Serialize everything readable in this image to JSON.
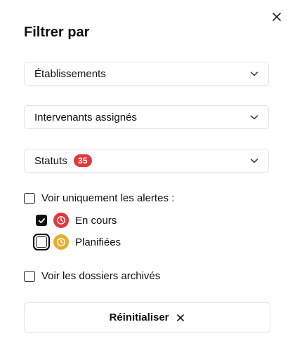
{
  "panel": {
    "title": "Filtrer par",
    "close_icon": "close-icon"
  },
  "filters": {
    "etablissements": {
      "label": "Établissements",
      "icon": "chevron-down-icon"
    },
    "intervenants": {
      "label": "Intervenants assignés",
      "icon": "chevron-down-icon"
    },
    "statuts": {
      "label": "Statuts",
      "count": "35",
      "badge_color": "#e2383d",
      "icon": "chevron-down-icon"
    }
  },
  "alerts": {
    "label": "Voir uniquement les alertes :",
    "checked": false,
    "options": [
      {
        "label": "En cours",
        "checked": true,
        "icon": "clock-icon",
        "color": "#e2383d"
      },
      {
        "label": "Planifiées",
        "checked": false,
        "icon": "clock-icon",
        "color": "#e9ad2c"
      }
    ]
  },
  "archived": {
    "label": "Voir les dossiers archivés",
    "checked": false
  },
  "reset": {
    "label": "Réinitialiser",
    "icon": "close-icon"
  }
}
